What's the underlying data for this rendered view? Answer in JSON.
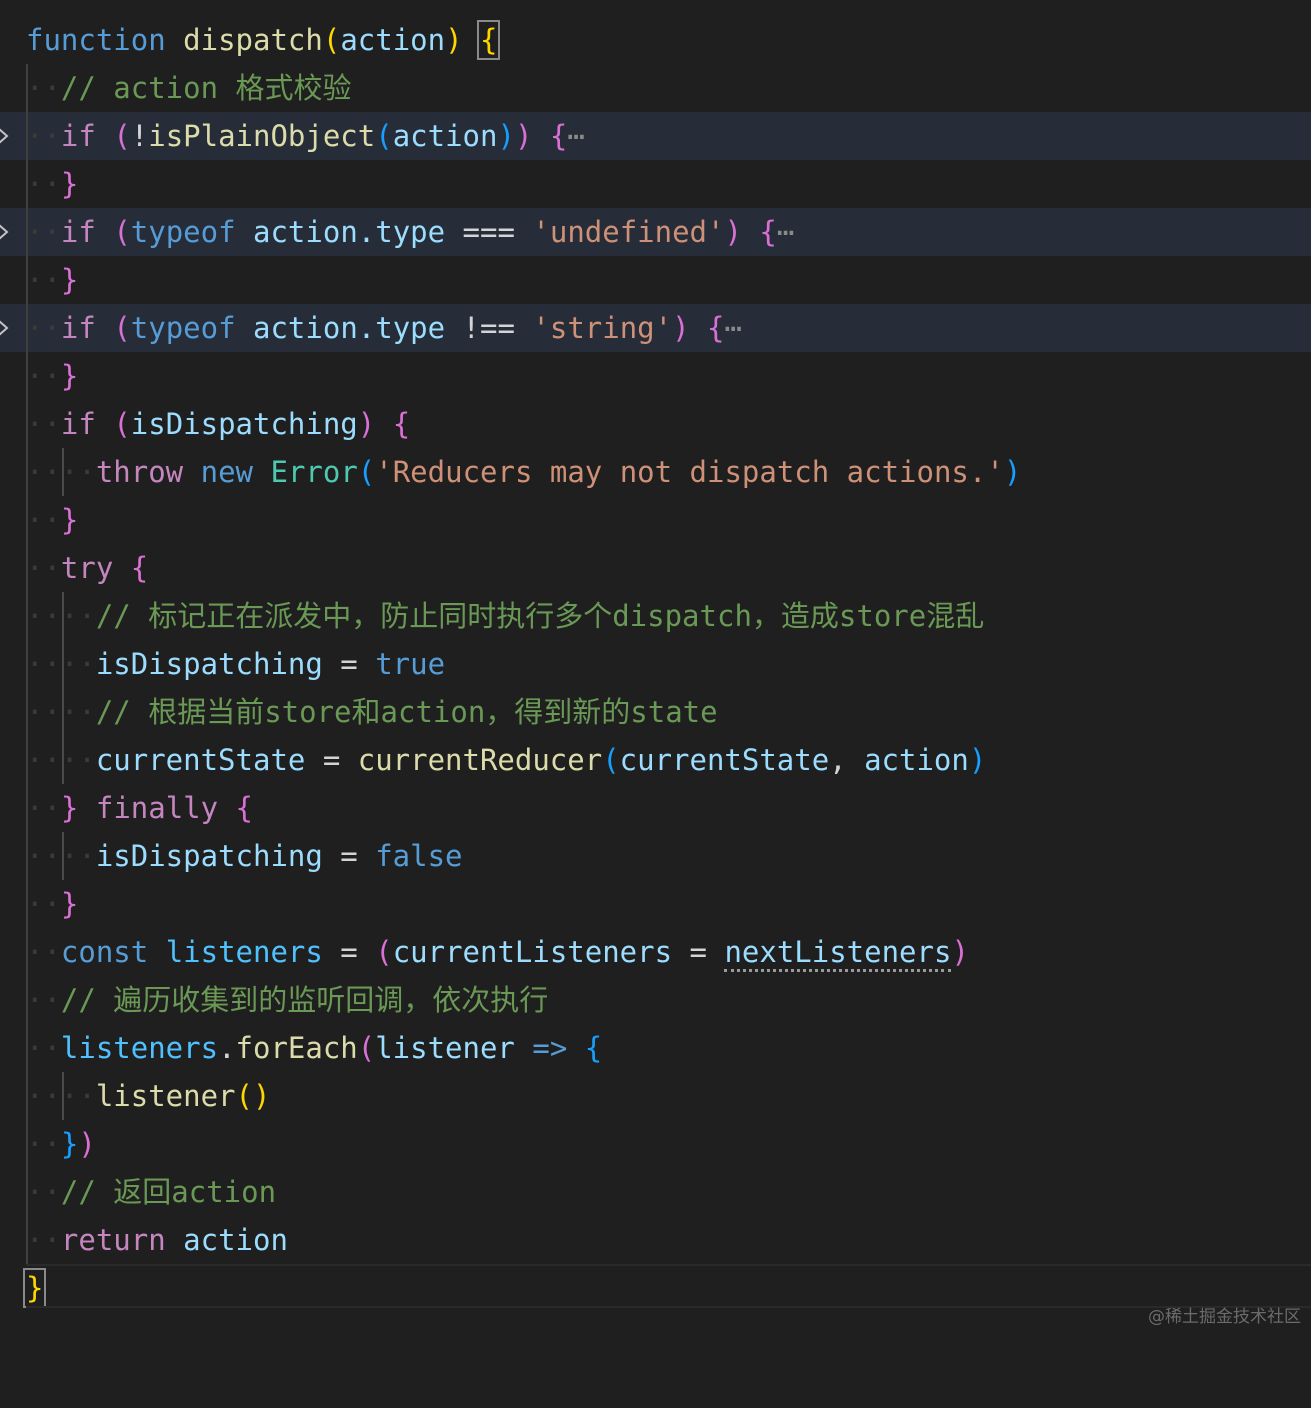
{
  "editor": {
    "language": "javascript",
    "theme_colors": {
      "background": "#1f1f1f",
      "folded_line_highlight": "#262d38",
      "keyword": "#569cd6",
      "control": "#c586c0",
      "function": "#dcdcaa",
      "variable": "#9cdcfe",
      "string": "#ce9178",
      "comment": "#6a9955",
      "type": "#4ec9b0",
      "bracket_gold": "#ffd700",
      "bracket_purple": "#da70d6",
      "bracket_blue": "#179fff"
    },
    "tokens": {
      "function_kw": "function",
      "dispatch_name": "dispatch",
      "param_action": "action",
      "cmt_action_check": "// action 格式校验",
      "if_kw": "if",
      "isPlainObject": "isPlainObject",
      "typeof_kw": "typeof",
      "action_type": "action.type",
      "strict_eq": "===",
      "strict_neq": "!==",
      "str_undefined": "'undefined'",
      "str_string": "'string'",
      "ellipsis": "⋯",
      "isDispatching": "isDispatching",
      "throw_kw": "throw",
      "new_kw": "new",
      "error_type": "Error",
      "err_msg": "'Reducers may not dispatch actions.'",
      "try_kw": "try",
      "cmt_mark_dispatching": "// 标记正在派发中，防止同时执行多个dispatch，造成store混乱",
      "true_kw": "true",
      "cmt_get_state": "// 根据当前store和action，得到新的state",
      "currentState": "currentState",
      "currentReducer": "currentReducer",
      "finally_kw": "finally",
      "false_kw": "false",
      "const_kw": "const",
      "listeners": "listeners",
      "currentListeners": "currentListeners",
      "nextListeners": "nextListeners",
      "cmt_traverse": "// 遍历收集到的监听回调，依次执行",
      "forEach": "forEach",
      "listener": "listener",
      "arrow": "=>",
      "cmt_return": "// 返回action",
      "return_kw": "return"
    }
  },
  "watermark": "@稀土掘金技术社区"
}
